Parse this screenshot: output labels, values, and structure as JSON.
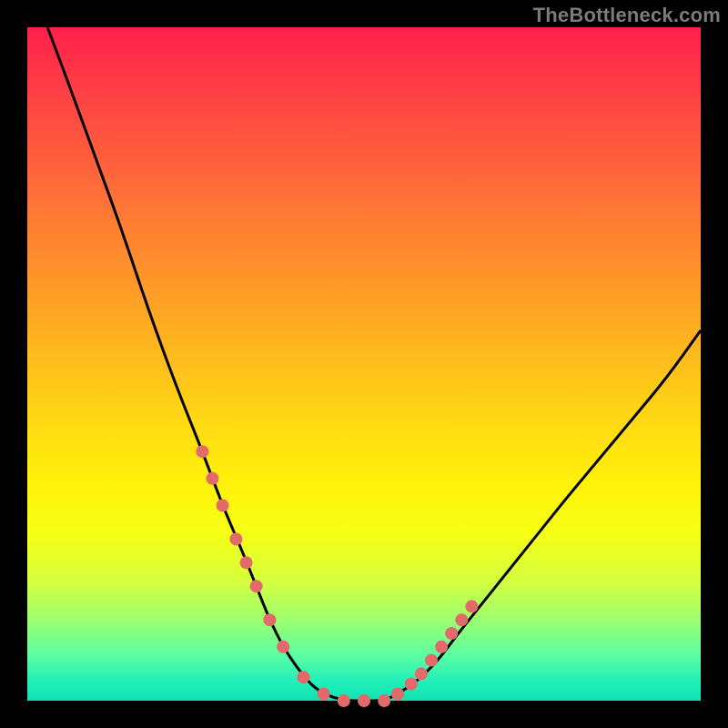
{
  "watermark": "TheBottleneck.com",
  "chart_data": {
    "type": "line",
    "title": "",
    "xlabel": "",
    "ylabel": "",
    "xlim": [
      0,
      100
    ],
    "ylim": [
      0,
      100
    ],
    "grid": false,
    "legend": false,
    "series": [
      {
        "name": "curve",
        "color": "#000000",
        "x": [
          3,
          6,
          10,
          14,
          18,
          22,
          26,
          29,
          32,
          34,
          36,
          38,
          40,
          42,
          44,
          47,
          50,
          53,
          55,
          58,
          61,
          64,
          68,
          72,
          76,
          80,
          85,
          90,
          95,
          100
        ],
        "y": [
          100,
          92,
          81,
          70,
          58,
          47,
          37,
          29,
          22,
          17,
          12,
          8,
          5,
          2.5,
          1,
          0,
          0,
          0,
          1,
          3,
          6,
          10,
          15,
          20,
          25,
          30,
          36,
          42,
          48,
          55
        ]
      }
    ],
    "markers": {
      "name": "highlight-dots",
      "color": "#e26a6a",
      "radius_px": 7,
      "x": [
        26,
        27.5,
        29,
        31,
        32.5,
        34,
        36,
        38,
        41,
        44,
        47,
        50,
        53,
        55,
        57,
        58.5,
        60,
        61.5,
        63,
        64.5,
        66
      ],
      "y": [
        37,
        33,
        29,
        24,
        20.5,
        17,
        12,
        8,
        3.5,
        1,
        0,
        0,
        0,
        1,
        2.5,
        4,
        6,
        8,
        10,
        12,
        14
      ]
    },
    "background_gradient": {
      "direction": "top-to-bottom",
      "stops": [
        {
          "pos": 0,
          "color": "#ff1f4b"
        },
        {
          "pos": 50,
          "color": "#ffd814"
        },
        {
          "pos": 75,
          "color": "#f6ff14"
        },
        {
          "pos": 100,
          "color": "#10e0b4"
        }
      ]
    }
  }
}
